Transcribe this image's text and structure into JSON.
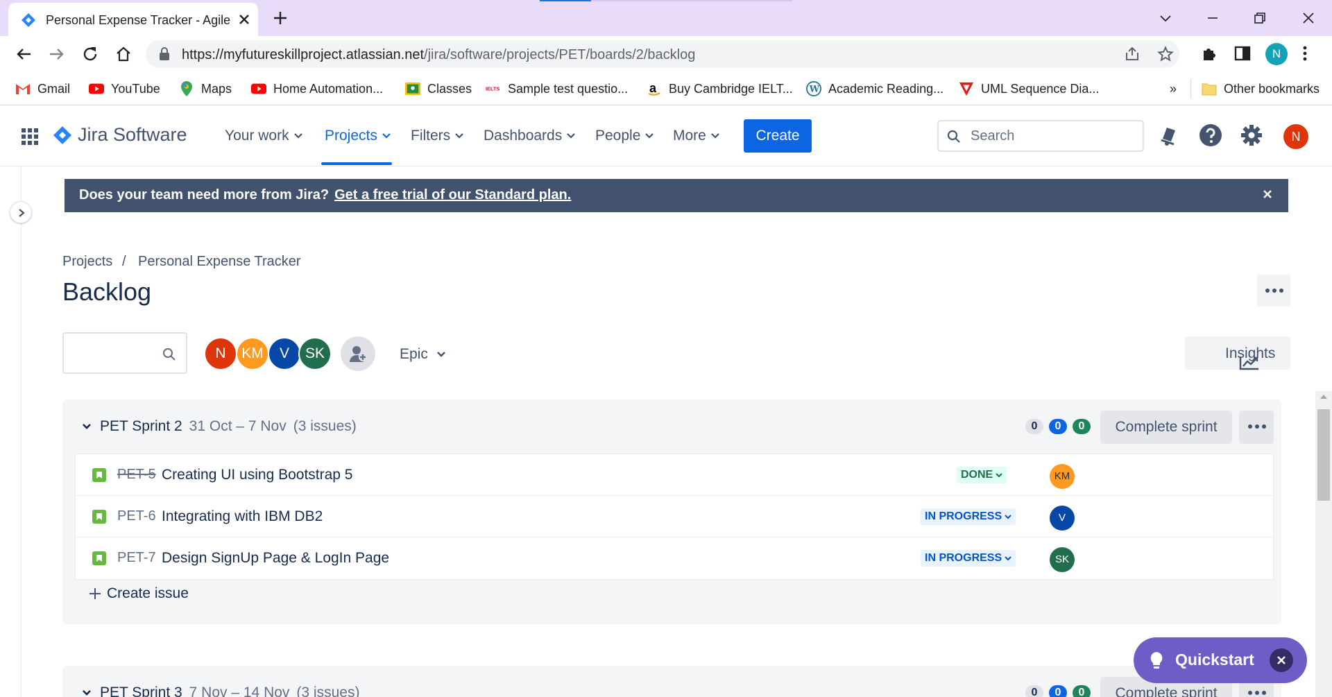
{
  "browser": {
    "tab_title": "Personal Expense Tracker - Agile board - Jira",
    "url_host": "https://myfutureskillproject.atlassian.net",
    "url_path": "/jira/software/projects/PET/boards/2/backlog",
    "profile_initial": "N",
    "bookmarks": [
      {
        "label": "Gmail",
        "icon": "gmail-icon"
      },
      {
        "label": "YouTube",
        "icon": "youtube-icon"
      },
      {
        "label": "Maps",
        "icon": "maps-icon"
      },
      {
        "label": "Home Automation...",
        "icon": "youtube-icon"
      },
      {
        "label": "Classes",
        "icon": "classroom-icon"
      },
      {
        "label": "Sample test questio...",
        "icon": "ielts-icon"
      },
      {
        "label": "Buy Cambridge IELT...",
        "icon": "amazon-icon"
      },
      {
        "label": "Academic Reading...",
        "icon": "wordpress-icon"
      },
      {
        "label": "UML Sequence Dia...",
        "icon": "visual-paradigm-icon"
      }
    ],
    "bookmarks_overflow": "»",
    "other_bookmarks": "Other bookmarks"
  },
  "jira_nav": {
    "product": "Jira Software",
    "items": [
      {
        "label": "Your work"
      },
      {
        "label": "Projects"
      },
      {
        "label": "Filters"
      },
      {
        "label": "Dashboards"
      },
      {
        "label": "People"
      },
      {
        "label": "More"
      }
    ],
    "active_item": "Projects",
    "create_label": "Create",
    "search_placeholder": "Search",
    "user_initial": "N"
  },
  "banner": {
    "message": "Does your team need more from Jira?",
    "link": "Get a free trial of our Standard plan."
  },
  "page": {
    "breadcrumb": [
      "Projects",
      "/",
      "Personal Expense Tracker"
    ],
    "title": "Backlog"
  },
  "filters": {
    "avatars": [
      {
        "initials": "N",
        "color": "#de350b"
      },
      {
        "initials": "KM",
        "color": "#ff991f"
      },
      {
        "initials": "V",
        "color": "#0747a6"
      },
      {
        "initials": "SK",
        "color": "#216e4e"
      }
    ],
    "epic_label": "Epic",
    "insights_label": "Insights"
  },
  "sprints": [
    {
      "name": "PET Sprint 2",
      "dates": "31 Oct – 7 Nov",
      "count": "(3 issues)",
      "todo": "0",
      "in_progress": "0",
      "done": "0",
      "action": "Complete sprint",
      "issues": [
        {
          "key": "PET-5",
          "summary": "Creating UI using Bootstrap 5",
          "status": "DONE",
          "assignee": "KM",
          "assignee_color": "#ff991f",
          "struck": true
        },
        {
          "key": "PET-6",
          "summary": "Integrating with IBM DB2",
          "status": "IN PROGRESS",
          "assignee": "V",
          "assignee_color": "#0747a6",
          "struck": false
        },
        {
          "key": "PET-7",
          "summary": "Design SignUp Page & LogIn Page",
          "status": "IN PROGRESS",
          "assignee": "SK",
          "assignee_color": "#216e4e",
          "struck": false
        }
      ],
      "create_issue": "Create issue"
    },
    {
      "name": "PET Sprint 3",
      "dates": "7 Nov – 14 Nov",
      "count": "(3 issues)",
      "todo": "0",
      "in_progress": "0",
      "done": "0",
      "action": "Complete sprint"
    }
  ],
  "quickstart": {
    "label": "Quickstart"
  }
}
